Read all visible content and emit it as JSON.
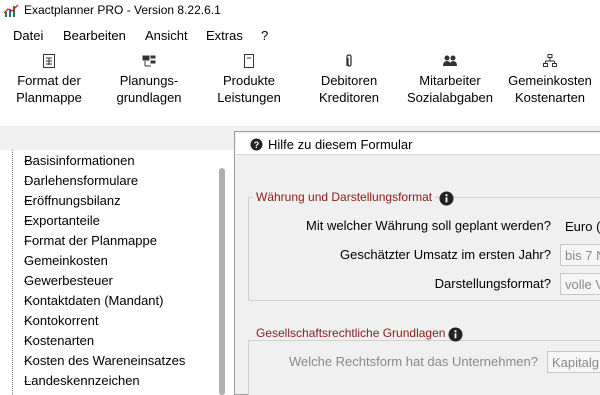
{
  "window": {
    "title": "Exactplanner PRO - Version 8.22.6.1"
  },
  "menu": {
    "items": [
      "Datei",
      "Bearbeiten",
      "Ansicht",
      "Extras",
      "?"
    ]
  },
  "ribbon": {
    "buttons": [
      {
        "line1": "Format der",
        "line2": "Planmappe",
        "icon": "document-grid-icon"
      },
      {
        "line1": "Planungs-",
        "line2": "grundlagen",
        "icon": "folder-tree-icon"
      },
      {
        "line1": "Produkte",
        "line2": "Leistungen",
        "icon": "product-box-icon"
      },
      {
        "line1": "Debitoren",
        "line2": "Kreditoren",
        "icon": "paperclip-icon"
      },
      {
        "line1": "Mitarbeiter",
        "line2": "Sozialabgaben",
        "icon": "people-icon"
      },
      {
        "line1": "Gemeinkosten",
        "line2": "Kostenarten",
        "icon": "org-chart-icon"
      }
    ]
  },
  "sidebar": {
    "items": [
      "Basisinformationen",
      "Darlehensformulare",
      "Eröffnungsbilanz",
      "Exportanteile",
      "Format der Planmappe",
      "Gemeinkosten",
      "Gewerbesteuer",
      "Kontaktdaten (Mandant)",
      "Kontokorrent",
      "Kostenarten",
      "Kosten des Wareneinsatzes",
      "Landeskennzeichen"
    ]
  },
  "form": {
    "help_label": "Hilfe zu diesem Formular",
    "group1": {
      "title": "Währung und Darstellungsformat",
      "currency_label": "Mit welcher Währung soll geplant werden?",
      "currency_value": "Euro (",
      "revenue_label": "Geschätzter Umsatz im ersten Jahr?",
      "revenue_value": "bis 7 N",
      "format_label": "Darstellungsformat?",
      "format_value": "volle V"
    },
    "group2": {
      "title": "Gesellschaftsrechtliche Grundlagen",
      "legalform_label": "Welche Rechtsform hat das Unternehmen?",
      "legalform_value": "Kapitalg"
    }
  },
  "colors": {
    "group_title": "#8b1a1a",
    "panel_bg": "#f0f0f0"
  }
}
